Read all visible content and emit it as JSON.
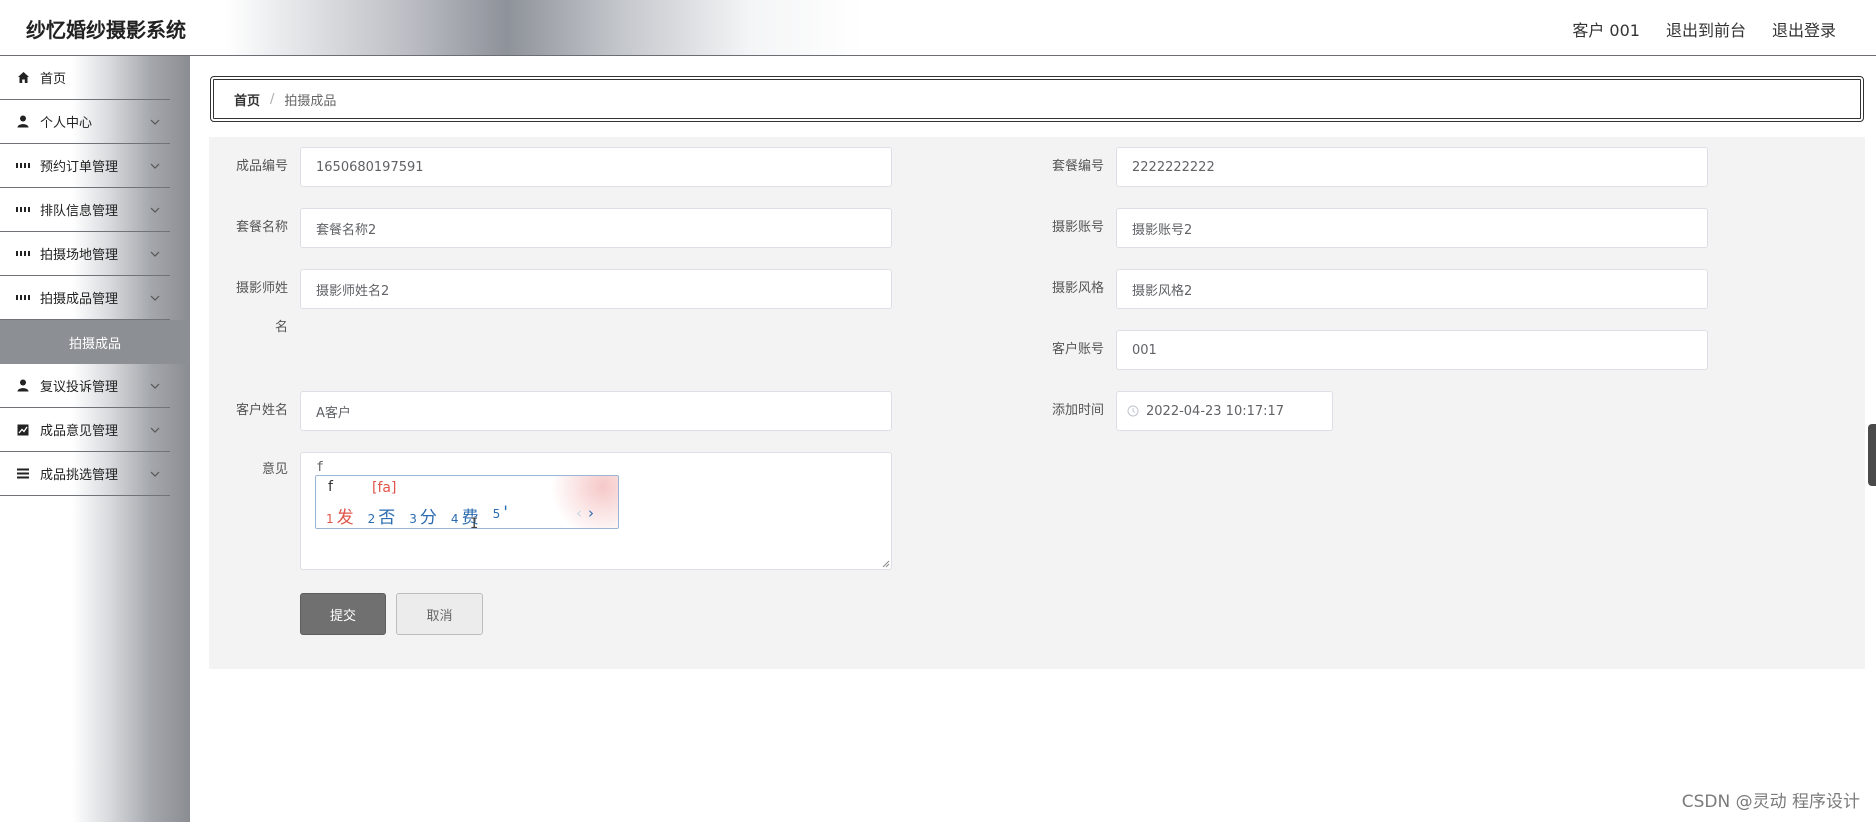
{
  "header": {
    "title": "纱忆婚纱摄影系统",
    "user": "客户 001",
    "front": "退出到前台",
    "logout": "退出登录"
  },
  "sidebar": {
    "items": [
      {
        "label": "首页",
        "icon": "home-icon"
      },
      {
        "label": "个人中心",
        "icon": "user-icon"
      },
      {
        "label": "预约订单管理",
        "icon": "grid-icon"
      },
      {
        "label": "排队信息管理",
        "icon": "grid-icon"
      },
      {
        "label": "拍摄场地管理",
        "icon": "grid-icon"
      },
      {
        "label": "拍摄成品管理",
        "icon": "grid-icon"
      },
      {
        "label": "拍摄成品",
        "icon": ""
      },
      {
        "label": "复议投诉管理",
        "icon": "user-icon"
      },
      {
        "label": "成品意见管理",
        "icon": "chart-icon"
      },
      {
        "label": "成品挑选管理",
        "icon": "list-icon"
      }
    ]
  },
  "breadcrumb": {
    "home": "首页",
    "sep": "/",
    "current": "拍摄成品"
  },
  "form": {
    "product_no": {
      "label": "成品编号",
      "value": "1650680197591"
    },
    "package_no": {
      "label": "套餐编号",
      "value": "2222222222"
    },
    "package_name": {
      "label": "套餐名称",
      "value": "套餐名称2"
    },
    "photographer_account": {
      "label": "摄影账号",
      "value": "摄影账号2"
    },
    "photographer_name": {
      "label1": "摄影师姓",
      "label2": "名",
      "value": "摄影师姓名2"
    },
    "style": {
      "label": "摄影风格",
      "value": "摄影风格2"
    },
    "customer_account": {
      "label": "客户账号",
      "value": "001"
    },
    "customer_name": {
      "label": "客户姓名",
      "value": "A客户"
    },
    "add_time": {
      "label": "添加时间",
      "value": "2022-04-23 10:17:17"
    },
    "opinion": {
      "label": "意见",
      "typed": "f"
    },
    "submit": "提交",
    "cancel": "取消"
  },
  "ime": {
    "composition": "f",
    "pinyin": "[fa]",
    "candidates": [
      {
        "num": "1",
        "text": "发"
      },
      {
        "num": "2",
        "text": "否"
      },
      {
        "num": "3",
        "text": "分"
      },
      {
        "num": "4",
        "text": "费"
      },
      {
        "num": "5",
        "text": "'"
      }
    ],
    "prev": "‹",
    "next": "›"
  },
  "watermark": "CSDN @灵动 程序设计"
}
